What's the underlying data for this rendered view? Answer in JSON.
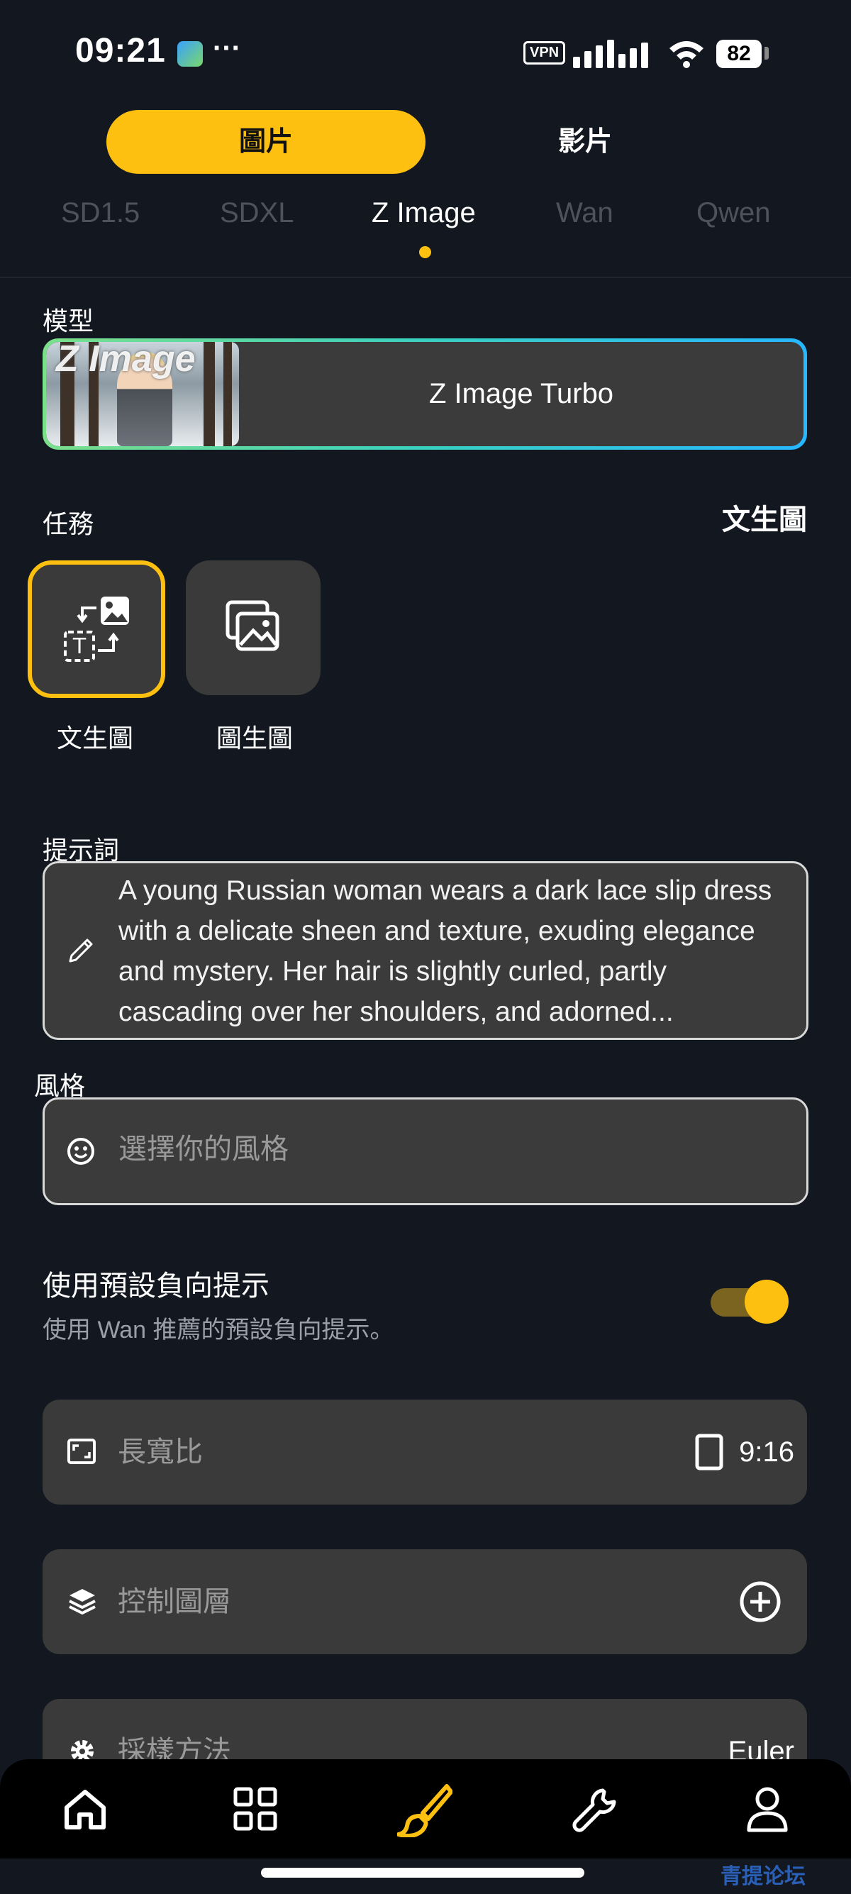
{
  "status_bar": {
    "time": "09:21",
    "dots": "···",
    "vpn": "VPN",
    "battery": "82"
  },
  "media_toggle": {
    "active": "圖片",
    "inactive": "影片"
  },
  "model_tabs": [
    "SD1.5",
    "SDXL",
    "Z Image",
    "Wan",
    "Qwen"
  ],
  "model": {
    "label": "模型",
    "thumb_text": "Z Image",
    "name": "Z Image Turbo"
  },
  "task": {
    "label": "任務",
    "current": "文生圖",
    "options": [
      "文生圖",
      "圖生圖"
    ]
  },
  "prompt": {
    "label": "提示詞",
    "text": "A young Russian woman wears a dark lace slip dress with a delicate sheen and texture, exuding elegance and mystery. Her hair is slightly curled, partly cascading over her shoulders, and adorned..."
  },
  "style": {
    "label": "風格",
    "placeholder": "選擇你的風格"
  },
  "negative_prompt": {
    "title": "使用預設負向提示",
    "subtitle": "使用 Wan 推薦的預設負向提示。",
    "enabled": true
  },
  "rows": {
    "aspect_label": "長寬比",
    "aspect_value": "9:16",
    "control_label": "控制圖層",
    "sampler_label": "採樣方法",
    "sampler_value": "Euler"
  },
  "watermark": "青提论坛",
  "colors": {
    "accent": "#FDC010",
    "background": "#121720",
    "card": "#3a3a3a"
  }
}
